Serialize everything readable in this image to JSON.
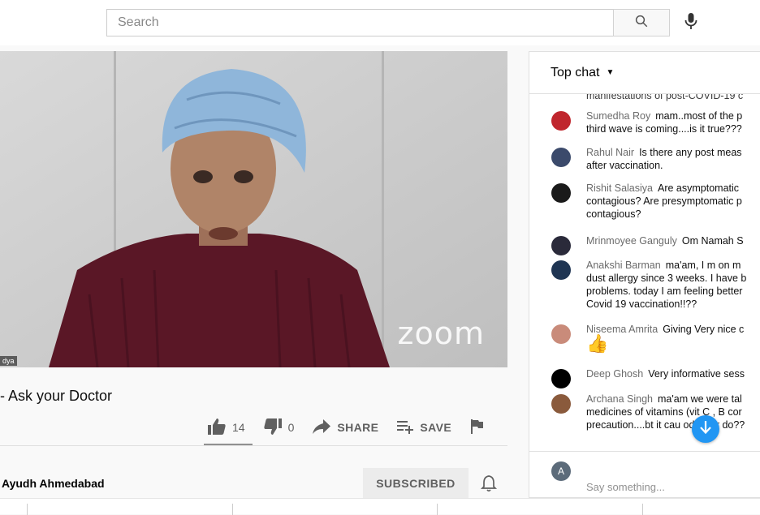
{
  "search": {
    "placeholder": "Search"
  },
  "video": {
    "watermark": "zoom",
    "participant_label": "dya"
  },
  "title": "- Ask your Doctor",
  "actions": {
    "likes": "14",
    "dislikes": "0",
    "share": "SHARE",
    "save": "SAVE"
  },
  "channel": {
    "name": "Ayudh Ahmedabad",
    "subscribe_label": "SUBSCRIBED"
  },
  "chat": {
    "header": "Top chat",
    "partial_top": "manifestations of post-COVID-19 c",
    "messages": [
      {
        "author": "Sumedha Roy",
        "text": "mam..most of the p third wave is coming....is it true???",
        "avatar_color": "#c0262d"
      },
      {
        "author": "Rahul Nair",
        "text": "Is there any post meas after vaccination.",
        "avatar_color": "#3b4a6b"
      },
      {
        "author": "Rishit Salasiya",
        "text": "Are asymptomatic contagious? Are presymptomatic p contagious?",
        "avatar_color": "#1a1a1a"
      },
      {
        "author": "Mrinmoyee Ganguly",
        "text": "Om Namah S",
        "avatar_color": "#2a2a3a"
      },
      {
        "author": "Anakshi Barman",
        "text": "ma'am, I m on m dust allergy since 3 weeks. I have b problems. today I am feeling better Covid 19 vaccination!!??",
        "avatar_color": "#1f3553"
      },
      {
        "author": "Niseema Amrita",
        "text": "Giving Very nice c",
        "emoji": "👍",
        "avatar_color": "#c98b7a"
      },
      {
        "author": "Deep Ghosh",
        "text": "Very informative sess",
        "avatar_color": "#000000"
      },
      {
        "author": "Archana Singh",
        "text": "ma'am we were tal medicines of vitamins (vit C , B cor precaution....bt it cau   ody pair do??",
        "avatar_color": "#8a5a3c"
      }
    ],
    "input_initial": "A",
    "input_placeholder": "Say something..."
  }
}
